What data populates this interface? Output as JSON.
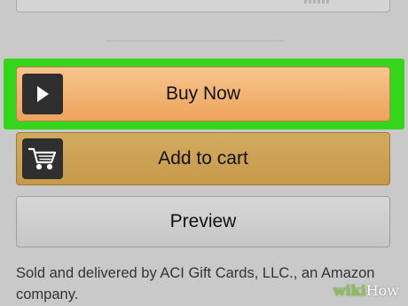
{
  "buttons": {
    "buy_now": "Buy Now",
    "add_to_cart": "Add to cart",
    "preview": "Preview"
  },
  "seller_text": "Sold and delivered by ACI Gift Cards, LLC., an Amazon company.",
  "watermark": {
    "prefix": "wiki",
    "suffix": "How"
  },
  "icons": {
    "buy_now": "play-icon",
    "add_to_cart": "cart-icon"
  },
  "colors": {
    "highlight": "#35d51b",
    "buy_now": "#eea35c",
    "add_to_cart": "#c99c4c",
    "preview": "#cfcfcf"
  }
}
